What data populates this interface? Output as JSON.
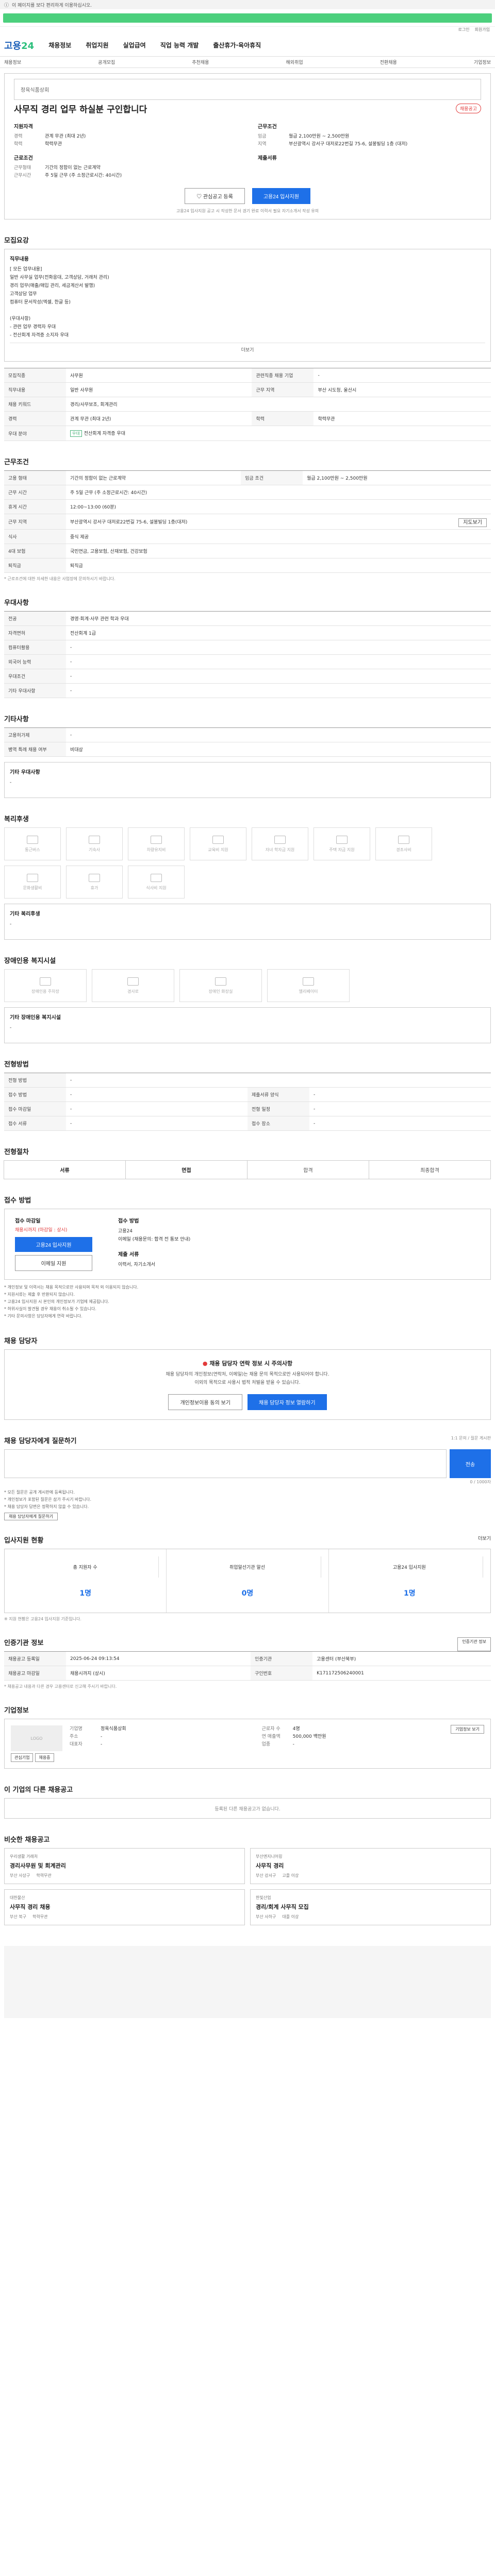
{
  "top": {
    "notice": "이 페이지를 보다 편리하게 이용하십시오."
  },
  "util": [
    "로그인",
    "회원가입"
  ],
  "gnb": {
    "logo_a": "고용",
    "logo_b": "24",
    "menus": [
      "채용정보",
      "취업지원",
      "실업급여",
      "직업 능력 개발",
      "출산휴가·육아휴직"
    ]
  },
  "subnav": [
    "채용정보",
    "공개모집",
    "추천채용",
    "해외취업",
    "전환채용",
    "기업정보"
  ],
  "job": {
    "company": "정육식품상회",
    "title": "사무직 경리 업무 하실분 구인합니다",
    "badge": "채용공고",
    "left_head": "지원자격",
    "left": [
      [
        "경력",
        "관계 무관 (최대 2년)"
      ],
      [
        "학력",
        "학력무관"
      ]
    ],
    "left_head2": "근로조건",
    "left2": [
      [
        "근무형태",
        "기간의 정함이 없는 근로계약"
      ],
      [
        "근무시간",
        "주 5일 근무 (주 소정근로시간: 40시간)"
      ]
    ],
    "right_head": "근무조건",
    "right": [
      [
        "임금",
        "월급 2,100만원 ~ 2,500만원"
      ],
      [
        "지역",
        "부산광역시 강서구 대저로22번길 75-6, 설봉빌딩 1층 (대저)"
      ]
    ],
    "right_head2": "제출서류",
    "apply_interest": "관심공고 등록",
    "apply_now": "고용24 입사지원",
    "apply_note": "고용24 입사지원 공고 시 작성한 문서 경기 완료 이력서 필요 자기소개서 작성 유의"
  },
  "recruit": {
    "title": "모집요강",
    "desc_head": "직무내용",
    "desc": "[ 모든 업무내용]\n일반 사무실 업무(전화응대, 고객상담, 거래처 관리)\n경리 업무(매출/매입 관리, 세금계산서 발행)\n고객상담 업무\n컴퓨터 문서작성(엑셀, 한글 등)\n\n(우대사항)\n- 관련 업무 경력자 우대\n- 전산회계 자격증 소지자 우대",
    "more": "더보기",
    "rows": [
      [
        "모집직종",
        "사무원",
        "관련직종 채용 기업",
        "-"
      ],
      [
        "직무내용",
        "일반 사무원",
        "근무 지역",
        "부산 시도청, 울산시"
      ],
      [
        "채용 키워드",
        "경리/사무보조, 회계관리"
      ],
      [
        "경력",
        "관계 무관 (최대 2년)",
        "학력",
        "학력무관"
      ],
      [
        "우대 분야",
        "전산회계 자격증 우대"
      ]
    ]
  },
  "work": {
    "title": "근무조건",
    "rows": [
      [
        "고용 형태",
        "기간의 정함이 없는 근로계약",
        "임금 조건",
        "월급 2,100만원 ~ 2,500만원"
      ],
      [
        "근무 시간",
        "주 5일 근무 (주 소정근로시간: 40시간)"
      ],
      [
        "휴게 시간",
        "12:00~13:00 (60분)"
      ],
      [
        "근무 지역",
        "부산광역시 강서구 대저로22번길 75-6, 설봉빌딩 1층(대저)",
        "지도보기"
      ],
      [
        "식사",
        "중식 제공"
      ],
      [
        "4대 보험",
        "국민연금, 고용보험, 산재보험, 건강보험"
      ],
      [
        "퇴직금",
        "퇴직금"
      ]
    ],
    "note": "* 근로조건에 대한 자세한 내용은 사업장에 문의하시기 바랍니다."
  },
  "benefits": {
    "title": "우대사항",
    "rows": [
      [
        "전공",
        "경영·회계·사무 관련 학과 우대"
      ],
      [
        "자격면허",
        "전산회계 1급"
      ],
      [
        "컴퓨터활용",
        "-"
      ],
      [
        "외국어 능력",
        "-"
      ],
      [
        "우대조건",
        "-"
      ],
      [
        "기타 우대사항",
        "-"
      ]
    ]
  },
  "other": {
    "title": "기타사항",
    "rows": [
      [
        "고용허가제",
        "-"
      ],
      [
        "병역 특례 채용 여부",
        "비대상"
      ]
    ],
    "etc_head": "기타 우대사항",
    "etc": "-"
  },
  "welfare": {
    "title": "복리후생",
    "items": [
      "통근버스",
      "기숙사",
      "차량유지비",
      "교육비 지원",
      "자녀 학자금 지원",
      "주택 자금 지원",
      "경조사비",
      "문화생활비",
      "휴가",
      "식사비 지원"
    ],
    "etc_head": "기타 복리후생",
    "etc": "-"
  },
  "disabled": {
    "title": "장애인용 복지시설",
    "items": [
      "장애인용 주차장",
      "경사로",
      "장애인 화장실",
      "엘리베이터"
    ],
    "etc_head": "기타 장애인용 복지시설",
    "etc": "-"
  },
  "process": {
    "title": "전형방법",
    "rows": [
      [
        "전형 방법",
        "-"
      ],
      [
        "접수 방법",
        "-",
        "제출서류 양식",
        "-"
      ],
      [
        "접수 마감일",
        "-",
        "전형 일정",
        "-"
      ],
      [
        "접수 서류",
        "-",
        "접수 장소",
        "-"
      ]
    ]
  },
  "progress": {
    "title": "전형절차",
    "tabs": [
      "서류",
      "면접",
      "합격",
      "최종합격"
    ]
  },
  "how": {
    "title": "접수 방법",
    "period_head": "접수 마감일",
    "period": "채용시까지 (마감일 : 상시)",
    "apply_btn": "고용24 입사지원",
    "apply_btn2": "이메일 지원",
    "method_head": "접수 방법",
    "method": "고용24\n이메일 (채용문의: 합격 전 통보 안내)",
    "docs_head": "제출 서류",
    "docs": "이력서, 자기소개서",
    "bullets": [
      "* 개인정보 및 이력서는 채용 목적으로만 사용되며 목적 외 이용되지 않습니다.",
      "* 지원서류는 제출 후 반환되지 않습니다.",
      "* 고용24 입사지원 시 본인의 개인정보가 기업에 제공됩니다.",
      "* 허위사실이 발견될 경우 채용이 취소될 수 있습니다.",
      "* 기타 문의사항은 담당자에게 연락 바랍니다."
    ]
  },
  "manager": {
    "title": "채용 담당자",
    "warn": "채용 담당자 연락 정보 시 주의사항",
    "text": "채용 담당자의 개인정보(연락처, 이메일)는 채용 문의 목적으로만 사용되어야 합니다.\n이외의 목적으로 사용시 법적 처벌을 받을 수 있습니다.",
    "btn1": "개인정보이용 동의 보기",
    "btn2": "채용 담당자 정보 열람하기"
  },
  "qna": {
    "title": "채용 담당자에게 질문하기",
    "hint": "1:1 문의 / 질문 게시판",
    "btn": "전송",
    "count": "0 / 1000자",
    "bullets": [
      "* 모든 질문은 공개 게시판에 등록됩니다.",
      "* 개인정보가 포함된 질문은 삼가 주시기 바랍니다.",
      "* 채용 담당자 답변은 정확하지 않을 수 있습니다."
    ],
    "link": "채용 담당자에게 질문하기"
  },
  "stats": {
    "title": "입사지원 현황",
    "more": "더보기",
    "items": [
      [
        "총 지원자 수",
        "1명"
      ],
      [
        "취업알선기관 알선",
        "0명"
      ],
      [
        "고용24 입사지원",
        "1명"
      ]
    ],
    "note": "※ 지원 현황은 고용24 입사지원 기준입니다."
  },
  "info": {
    "title": "인증기관 정보",
    "btn": "인증기관 정보",
    "rows": [
      [
        "채용공고 등록일",
        "2025-06-24 09:13:54",
        "인증기관",
        "고용센터 (부산북부)"
      ],
      [
        "채용공고 마감일",
        "채용시까지 (상시)",
        "구인번호",
        "K171172506240001"
      ]
    ],
    "note": "* 채용공고 내용과 다른 경우 고용센터로 신고해 주시기 바랍니다."
  },
  "companyinfo": {
    "title": "기업정보",
    "logo": "LOGO",
    "name_k": "기업명",
    "name": "정육식품상회",
    "addr_k": "주소",
    "addr": "-",
    "ceo_k": "대표자",
    "ceo": "-",
    "emp_k": "근로자 수",
    "emp": "4명",
    "sales_k": "연 매출액",
    "sales": "500,000 백만원",
    "industry_k": "업종",
    "industry": "-",
    "btn": "기업정보 보기",
    "btn2": "관심기업",
    "btn3": "채용중"
  },
  "samecompany": {
    "title": "이 기업의 다른 채용공고",
    "empty": "등록된 다른 채용공고가 없습니다."
  },
  "similar": {
    "title": "비슷한 채용공고",
    "cards": [
      [
        "우리생활 거래처",
        "경리사무원 및 회계관리",
        "부산 사상구",
        "학력무관"
      ],
      [
        "부산엔지니어링",
        "사무직 경리",
        "부산 강서구",
        "고졸 이상"
      ],
      [
        "대한물산",
        "사무직 경리 채용",
        "부산 북구",
        "학력무관"
      ],
      [
        "한빛산업",
        "경리/회계 사무직 모집",
        "부산 사하구",
        "대졸 이상"
      ]
    ]
  }
}
